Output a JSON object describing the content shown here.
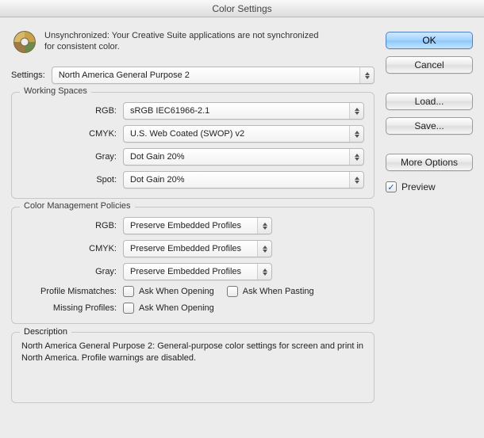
{
  "title": "Color Settings",
  "sync_notice": "Unsynchronized: Your Creative Suite applications are not synchronized for consistent color.",
  "settings_label": "Settings:",
  "settings_value": "North America General Purpose 2",
  "working_spaces": {
    "legend": "Working Spaces",
    "rows": {
      "rgb_label": "RGB:",
      "rgb_value": "sRGB IEC61966-2.1",
      "cmyk_label": "CMYK:",
      "cmyk_value": "U.S. Web Coated (SWOP) v2",
      "gray_label": "Gray:",
      "gray_value": "Dot Gain 20%",
      "spot_label": "Spot:",
      "spot_value": "Dot Gain 20%"
    }
  },
  "policies": {
    "legend": "Color Management Policies",
    "rows": {
      "rgb_label": "RGB:",
      "rgb_value": "Preserve Embedded Profiles",
      "cmyk_label": "CMYK:",
      "cmyk_value": "Preserve Embedded Profiles",
      "gray_label": "Gray:",
      "gray_value": "Preserve Embedded Profiles"
    },
    "profile_mismatches_label": "Profile Mismatches:",
    "missing_profiles_label": "Missing Profiles:",
    "ask_open_label": "Ask When Opening",
    "ask_paste_label": "Ask When Pasting"
  },
  "description": {
    "legend": "Description",
    "text": "North America General Purpose 2:  General-purpose color settings for screen and print in North America. Profile warnings are disabled."
  },
  "buttons": {
    "ok": "OK",
    "cancel": "Cancel",
    "load": "Load...",
    "save": "Save...",
    "more": "More Options"
  },
  "preview": {
    "label": "Preview",
    "checked": true
  }
}
